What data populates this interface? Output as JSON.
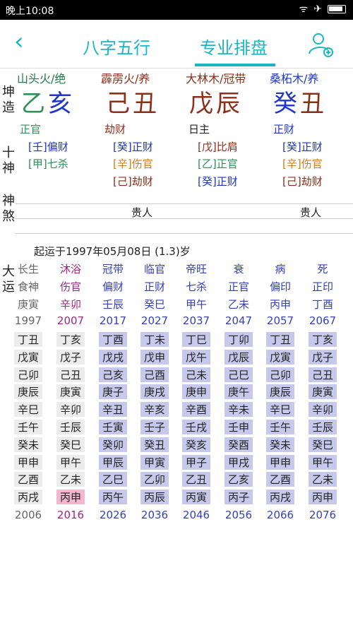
{
  "status_bar": {
    "time": "晚上10:08"
  },
  "nav": {
    "tab_bazi": "八字五行",
    "tab_paipan": "专业排盘"
  },
  "side_labels": {
    "gender": "坤造",
    "shishen": "十神",
    "shensha": "神煞",
    "dayun": "大运"
  },
  "pillars": [
    {
      "nayin": "山头火/绝",
      "stem": "乙",
      "branch": "亥",
      "stem_god": "正官",
      "hidden": [
        "[壬]偏财",
        "[甲]七杀"
      ],
      "shensha": ""
    },
    {
      "nayin": "霹雳火/养",
      "stem": "己",
      "branch": "丑",
      "stem_god": "劫财",
      "hidden": [
        "[癸]正财",
        "[辛]伤官",
        "[己]劫财"
      ],
      "shensha": "贵人"
    },
    {
      "nayin": "大林木/冠带",
      "stem": "戊",
      "branch": "辰",
      "stem_god": "日主",
      "hidden": [
        "[戊]比肩",
        "[乙]正官",
        "[癸]正财"
      ],
      "shensha": ""
    },
    {
      "nayin": "桑柘木/养",
      "stem": "癸",
      "branch": "丑",
      "stem_god": "正财",
      "hidden": [
        "[癸]正财",
        "[辛]伤官",
        "[己]劫财"
      ],
      "shensha": "贵人"
    }
  ],
  "qiyun": "起运于1997年05月08日 (1.3)岁",
  "dayun": {
    "stages": [
      "长生",
      "沐浴",
      "冠带",
      "临官",
      "帝旺",
      "衰",
      "病",
      "死"
    ],
    "gods": [
      "食神",
      "伤官",
      "偏财",
      "正财",
      "七杀",
      "正官",
      "偏印",
      "正印"
    ],
    "ganzhi": [
      "庚寅",
      "辛卯",
      "壬辰",
      "癸巳",
      "甲午",
      "乙未",
      "丙申",
      "丁酉"
    ],
    "start_years": [
      "1997",
      "2007",
      "2017",
      "2027",
      "2037",
      "2047",
      "2057",
      "2067"
    ],
    "liunian": [
      [
        "丁丑",
        "丁亥",
        "丁酉",
        "丁未",
        "丁巳",
        "丁卯",
        "丁丑",
        "丁亥"
      ],
      [
        "戊寅",
        "戊子",
        "戊戌",
        "戊申",
        "戊午",
        "戊辰",
        "戊寅",
        "戊子"
      ],
      [
        "己卯",
        "己丑",
        "己亥",
        "己酉",
        "己未",
        "己巳",
        "己卯",
        "己丑"
      ],
      [
        "庚辰",
        "庚寅",
        "庚子",
        "庚戌",
        "庚申",
        "庚午",
        "庚辰",
        "庚寅"
      ],
      [
        "辛巳",
        "辛卯",
        "辛丑",
        "辛亥",
        "辛酉",
        "辛未",
        "辛巳",
        "辛卯"
      ],
      [
        "壬午",
        "壬辰",
        "壬寅",
        "壬子",
        "壬戌",
        "壬申",
        "壬午",
        "壬辰"
      ],
      [
        "癸未",
        "癸巳",
        "癸卯",
        "癸丑",
        "癸亥",
        "癸酉",
        "癸未",
        "癸巳"
      ],
      [
        "甲申",
        "甲午",
        "甲辰",
        "甲寅",
        "甲子",
        "甲戌",
        "甲申",
        "甲午"
      ],
      [
        "乙酉",
        "乙未",
        "乙巳",
        "乙卯",
        "乙丑",
        "乙亥",
        "乙酉",
        "乙未"
      ],
      [
        "丙戌",
        "丙申",
        "丙午",
        "丙辰",
        "丙寅",
        "丙子",
        "丙戌",
        "丙申"
      ]
    ],
    "end_years": [
      "2006",
      "2016",
      "2026",
      "2036",
      "2046",
      "2056",
      "2066",
      "2076"
    ]
  },
  "colors": {
    "accent": "#19b6c6",
    "highlight": "#c6c8ec",
    "current_year": "#f5b6cf"
  }
}
